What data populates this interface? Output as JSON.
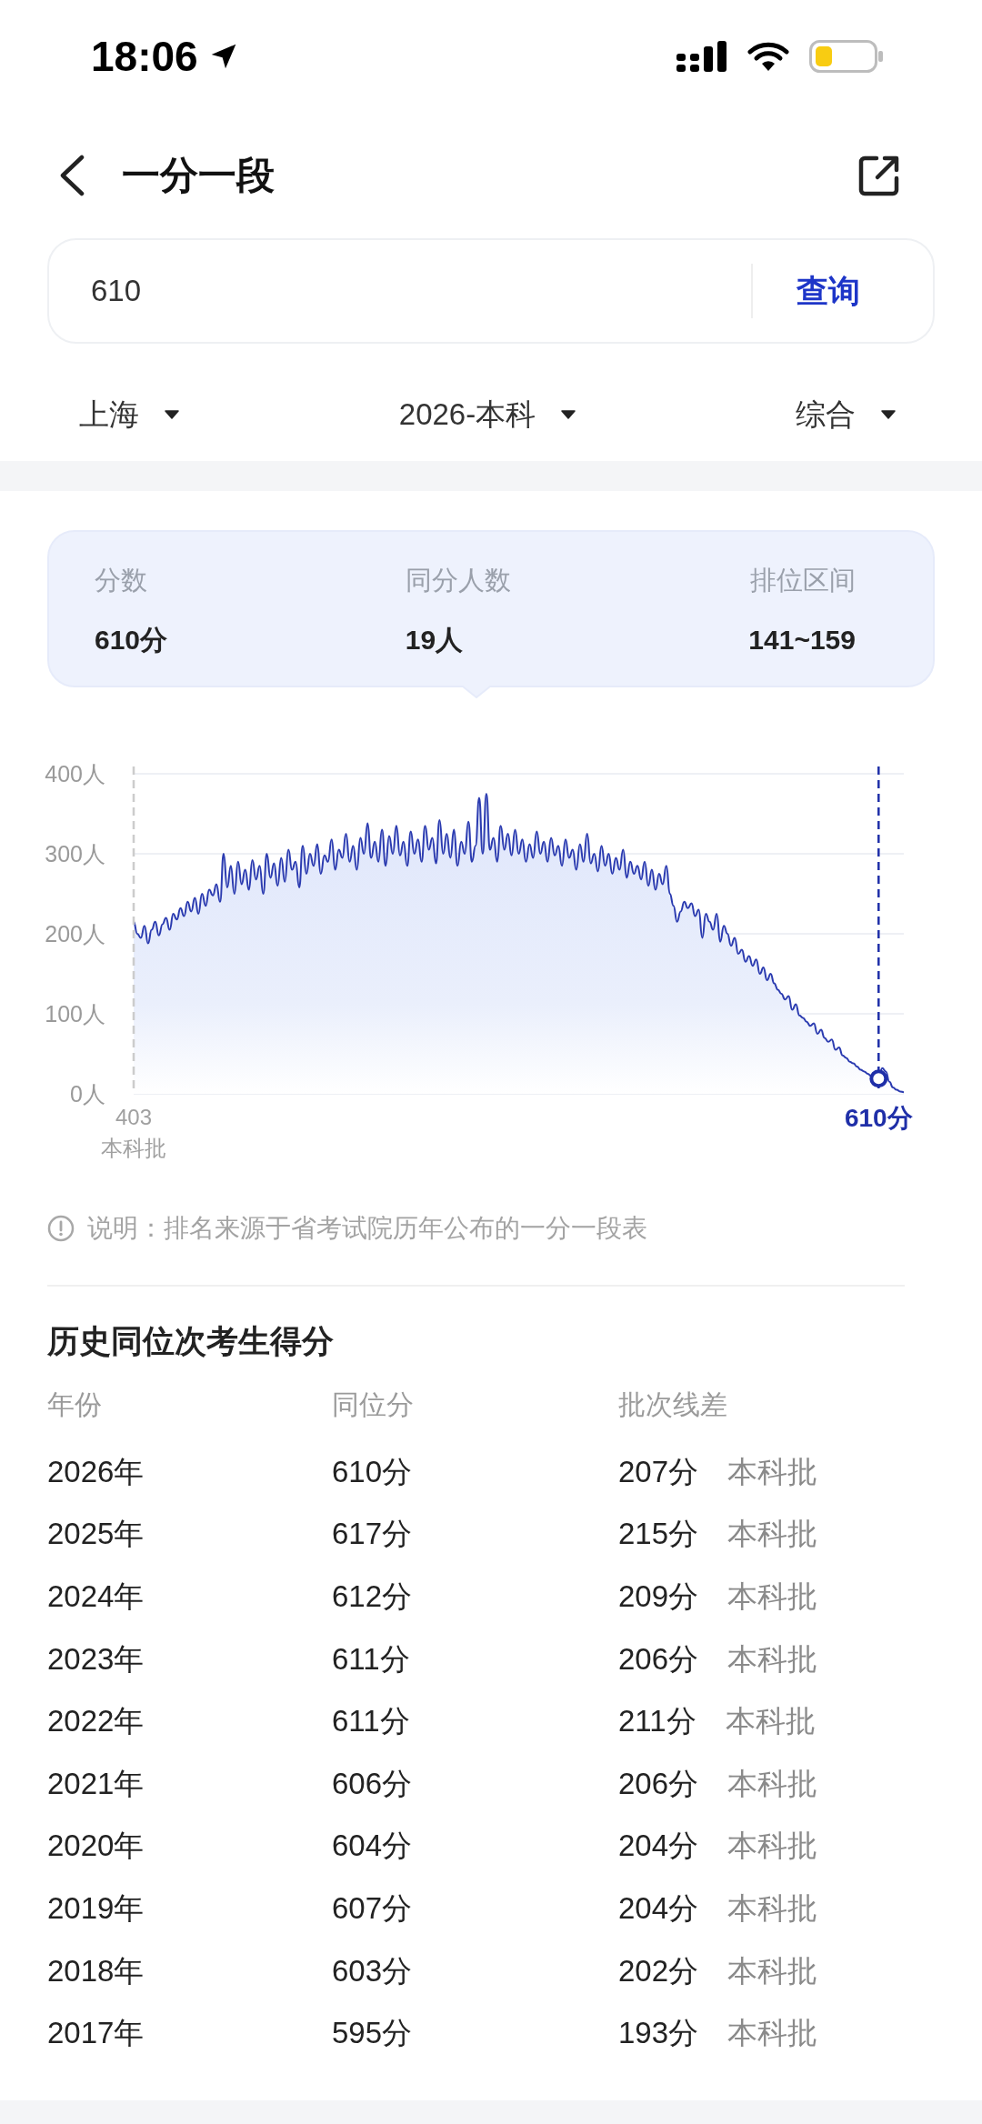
{
  "status_bar": {
    "time": "18:06"
  },
  "header": {
    "title": "一分一段"
  },
  "search": {
    "value": "610",
    "button": "查询"
  },
  "filters": [
    {
      "label": "上海"
    },
    {
      "label": "2026-本科"
    },
    {
      "label": "综合"
    }
  ],
  "summary": [
    {
      "label": "分数",
      "value": "610分"
    },
    {
      "label": "同分人数",
      "value": "19人"
    },
    {
      "label": "排位区间",
      "value": "141~159"
    }
  ],
  "distribution": {
    "chart_data": {
      "type": "area",
      "x": [
        403,
        404,
        405,
        406,
        407,
        408,
        409,
        410,
        411,
        412,
        413,
        414,
        415,
        416,
        417,
        418,
        419,
        420,
        421,
        422,
        423,
        424,
        425,
        426,
        427,
        428,
        429,
        430,
        431,
        432,
        433,
        434,
        435,
        436,
        437,
        438,
        439,
        440,
        441,
        442,
        443,
        444,
        445,
        446,
        447,
        448,
        449,
        450,
        451,
        452,
        453,
        454,
        455,
        456,
        457,
        458,
        459,
        460,
        461,
        462,
        463,
        464,
        465,
        466,
        467,
        468,
        469,
        470,
        471,
        472,
        473,
        474,
        475,
        476,
        477,
        478,
        479,
        480,
        481,
        482,
        483,
        484,
        485,
        486,
        487,
        488,
        489,
        490,
        491,
        492,
        493,
        494,
        495,
        496,
        497,
        498,
        499,
        500,
        501,
        502,
        503,
        504,
        505,
        506,
        507,
        508,
        509,
        510,
        511,
        512,
        513,
        514,
        515,
        516,
        517,
        518,
        519,
        520,
        521,
        522,
        523,
        524,
        525,
        526,
        527,
        528,
        529,
        530,
        531,
        532,
        533,
        534,
        535,
        536,
        537,
        538,
        539,
        540,
        541,
        542,
        543,
        544,
        545,
        546,
        547,
        548,
        549,
        550,
        551,
        552,
        553,
        554,
        555,
        556,
        557,
        558,
        559,
        560,
        561,
        562,
        563,
        564,
        565,
        566,
        567,
        568,
        569,
        570,
        571,
        572,
        573,
        574,
        575,
        576,
        577,
        578,
        579,
        580,
        581,
        582,
        583,
        584,
        585,
        586,
        587,
        588,
        589,
        590,
        591,
        592,
        593,
        594,
        595,
        596,
        597,
        598,
        599,
        600,
        601,
        602,
        603,
        604,
        605,
        606,
        607,
        608,
        609,
        610,
        611,
        612,
        613,
        614,
        615,
        616,
        617
      ],
      "values": [
        215,
        200,
        195,
        210,
        188,
        205,
        215,
        198,
        212,
        220,
        205,
        225,
        218,
        232,
        222,
        240,
        228,
        245,
        225,
        250,
        235,
        255,
        248,
        262,
        240,
        300,
        258,
        285,
        250,
        290,
        262,
        280,
        255,
        292,
        268,
        285,
        250,
        300,
        270,
        288,
        260,
        295,
        265,
        305,
        280,
        290,
        258,
        310,
        275,
        300,
        285,
        312,
        275,
        298,
        290,
        318,
        280,
        305,
        295,
        325,
        290,
        310,
        280,
        320,
        300,
        338,
        295,
        315,
        290,
        330,
        285,
        322,
        300,
        335,
        298,
        315,
        285,
        328,
        300,
        318,
        290,
        335,
        305,
        320,
        288,
        342,
        300,
        325,
        295,
        330,
        285,
        315,
        300,
        340,
        290,
        310,
        370,
        300,
        375,
        305,
        320,
        290,
        335,
        305,
        325,
        298,
        330,
        300,
        318,
        290,
        312,
        295,
        328,
        300,
        315,
        290,
        320,
        298,
        310,
        285,
        318,
        295,
        305,
        280,
        312,
        290,
        325,
        288,
        300,
        278,
        310,
        285,
        300,
        275,
        295,
        280,
        305,
        270,
        290,
        275,
        285,
        268,
        290,
        260,
        280,
        255,
        275,
        262,
        285,
        250,
        235,
        215,
        228,
        240,
        232,
        238,
        222,
        230,
        195,
        225,
        215,
        205,
        225,
        190,
        210,
        200,
        185,
        195,
        175,
        180,
        165,
        172,
        160,
        168,
        150,
        158,
        142,
        150,
        138,
        130,
        125,
        118,
        122,
        105,
        112,
        98,
        95,
        90,
        85,
        88,
        75,
        80,
        70,
        65,
        68,
        55,
        58,
        48,
        45,
        40,
        38,
        34,
        30,
        28,
        25,
        22,
        20,
        19,
        32,
        28,
        15,
        8,
        5,
        3,
        2
      ],
      "xlim": [
        403,
        617
      ],
      "ylim": [
        0,
        400
      ],
      "grid": true,
      "yticks": [
        {
          "value": 0,
          "label": "0人"
        },
        {
          "value": 100,
          "label": "100人"
        },
        {
          "value": 200,
          "label": "200人"
        },
        {
          "value": 300,
          "label": "300人"
        },
        {
          "value": 400,
          "label": "400人"
        }
      ],
      "xticks": [
        {
          "value": 403,
          "label": "403"
        },
        {
          "value": 610,
          "label": "610分"
        }
      ],
      "ref_lines": [
        {
          "axis": "x",
          "value": 403,
          "label": "本科批",
          "color": "#cccccc"
        },
        {
          "axis": "x",
          "value": 610,
          "color": "#1f2fa8"
        }
      ]
    }
  },
  "note": "说明：排名来源于省考试院历年公布的一分一段表",
  "history": {
    "title": "历史同位次考生得分",
    "columns": [
      "年份",
      "同位分",
      "批次线差"
    ],
    "rows": [
      {
        "year": "2026年",
        "score": "610分",
        "diff": "207分",
        "batch": "本科批"
      },
      {
        "year": "2025年",
        "score": "617分",
        "diff": "215分",
        "batch": "本科批"
      },
      {
        "year": "2024年",
        "score": "612分",
        "diff": "209分",
        "batch": "本科批"
      },
      {
        "year": "2023年",
        "score": "611分",
        "diff": "206分",
        "batch": "本科批"
      },
      {
        "year": "2022年",
        "score": "611分",
        "diff": "211分",
        "batch": "本科批"
      },
      {
        "year": "2021年",
        "score": "606分",
        "diff": "206分",
        "batch": "本科批"
      },
      {
        "year": "2020年",
        "score": "604分",
        "diff": "204分",
        "batch": "本科批"
      },
      {
        "year": "2019年",
        "score": "607分",
        "diff": "204分",
        "batch": "本科批"
      },
      {
        "year": "2018年",
        "score": "603分",
        "diff": "202分",
        "batch": "本科批"
      },
      {
        "year": "2017年",
        "score": "595分",
        "diff": "193分",
        "batch": "本科批"
      }
    ]
  }
}
